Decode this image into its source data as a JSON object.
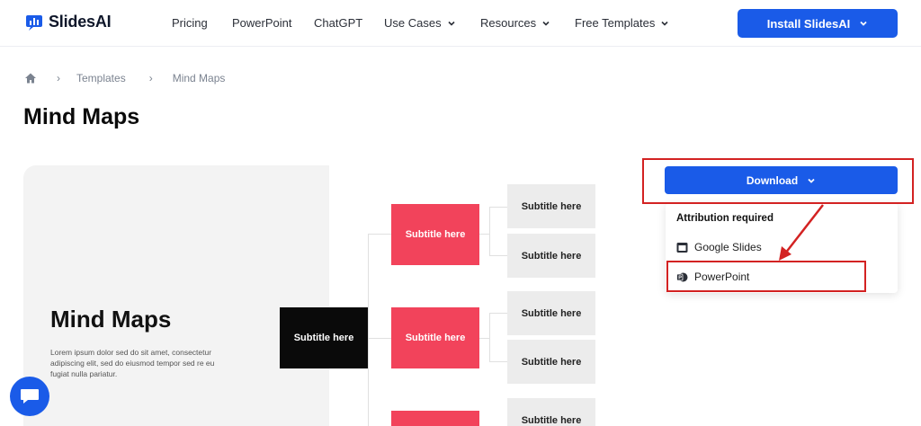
{
  "header": {
    "logo_text": "SlidesAI",
    "nav": [
      {
        "label": "Pricing",
        "dropdown": false
      },
      {
        "label": "PowerPoint",
        "dropdown": false
      },
      {
        "label": "ChatGPT",
        "dropdown": false
      },
      {
        "label": "Use Cases",
        "dropdown": true
      },
      {
        "label": "Resources",
        "dropdown": true
      },
      {
        "label": "Free Templates",
        "dropdown": true
      }
    ],
    "install_label": "Install SlidesAI"
  },
  "breadcrumb": {
    "home_icon": "home-icon",
    "items": [
      "Templates",
      "Mind Maps"
    ]
  },
  "page_title": "Mind Maps",
  "preview": {
    "slide_title": "Mind Maps",
    "slide_body": "Lorem ipsum dolor sed do sit amet, consectetur adipiscing elit, sed do eiusmod tempor sed re eu fugiat nulla pariatur.",
    "center_node": "Subtitle here",
    "mid_nodes": [
      "Subtitle here",
      "Subtitle here"
    ],
    "leaf_nodes": [
      "Subtitle here",
      "Subtitle here",
      "Subtitle here",
      "Subtitle here",
      "Subtitle here"
    ]
  },
  "download": {
    "button_label": "Download",
    "dropdown_heading": "Attribution required",
    "options": [
      {
        "label": "Google Slides",
        "icon": "slides-icon"
      },
      {
        "label": "PowerPoint",
        "icon": "powerpoint-icon"
      }
    ]
  },
  "colors": {
    "brand_blue": "#1a5be8",
    "node_red": "#f2435b",
    "annotation_red": "#d32222"
  }
}
